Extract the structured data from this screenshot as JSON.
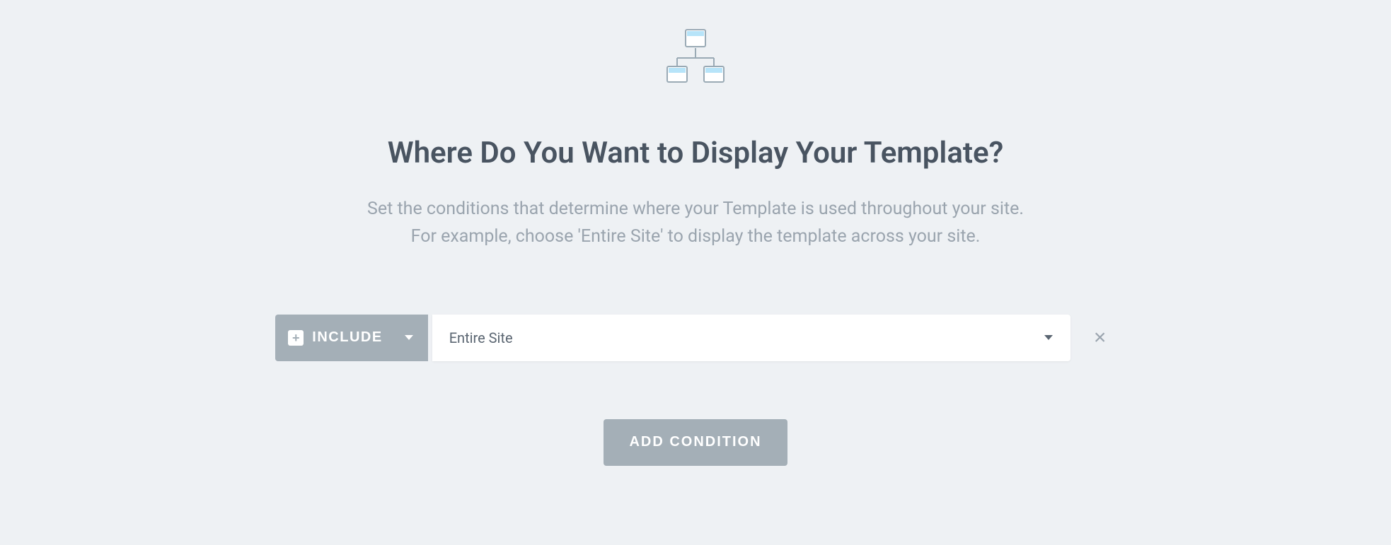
{
  "header": {
    "title": "Where Do You Want to Display Your Template?",
    "subtitle_line1": "Set the conditions that determine where your Template is used throughout your site.",
    "subtitle_line2": "For example, choose 'Entire Site' to display the template across your site."
  },
  "condition": {
    "mode_label": "INCLUDE",
    "scope_value": "Entire Site"
  },
  "actions": {
    "add_condition_label": "ADD CONDITION"
  },
  "icons": {
    "sitemap": "sitemap-icon",
    "plus": "+",
    "caret_down": "caret-down",
    "remove": "×"
  },
  "colors": {
    "background": "#eef1f4",
    "muted": "#a4afb7",
    "text_primary": "#495461",
    "text_secondary": "#9aa4ae",
    "accent_fill": "#b7e4f9",
    "accent_stroke": "#8da3b0"
  }
}
